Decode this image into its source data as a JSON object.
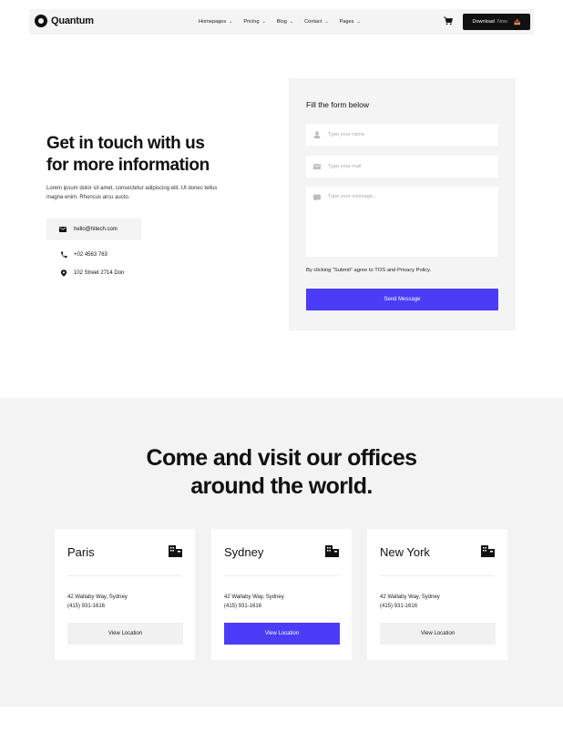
{
  "nav": {
    "brand": "Quantum",
    "menu": [
      {
        "label": "Homepages"
      },
      {
        "label": "Pricing"
      },
      {
        "label": "Blog"
      },
      {
        "label": "Contact"
      },
      {
        "label": "Pages"
      }
    ],
    "download_label": "Download",
    "download_suffix": "Now",
    "cart_icon": "cart-icon"
  },
  "hero": {
    "title_line1": "Get in touch with us",
    "title_line2": "for more information",
    "subtitle": "Lorem ipsum dolor sit amet, consectetur adipiscing elit. Ut donec tellus magna enim. Rhoncus arcu aucto.",
    "email": "hello@hitech.com",
    "phone": "+02 4563 763",
    "address": "102 Street 2714 Don"
  },
  "form": {
    "title": "Fill the form below",
    "name_placeholder": "Type your name",
    "mail_placeholder": "Type your mail",
    "message_placeholder": "Type your message...",
    "terms": "By clicking “Submit” agree to TOS and Privacy Policy.",
    "submit_label": "Send Message"
  },
  "offices": {
    "title_line1": "Come and visit our offices",
    "title_line2": "around the world.",
    "cards": [
      {
        "city": "Paris",
        "address": "42 Wallaby Way, Sydney",
        "phone": "(415) 931-1616",
        "button": "View Location"
      },
      {
        "city": "Sydney",
        "address": "42 Wallaby Way, Sydney",
        "phone": "(415) 931-1616",
        "button": "View Location"
      },
      {
        "city": "New York",
        "address": "42 Wallaby Way, Sydney",
        "phone": "(415) 931-1616",
        "button": "View Location"
      }
    ]
  },
  "colors": {
    "accent": "#4b3cf7",
    "dark": "#111111",
    "panel": "#f4f4f4"
  }
}
